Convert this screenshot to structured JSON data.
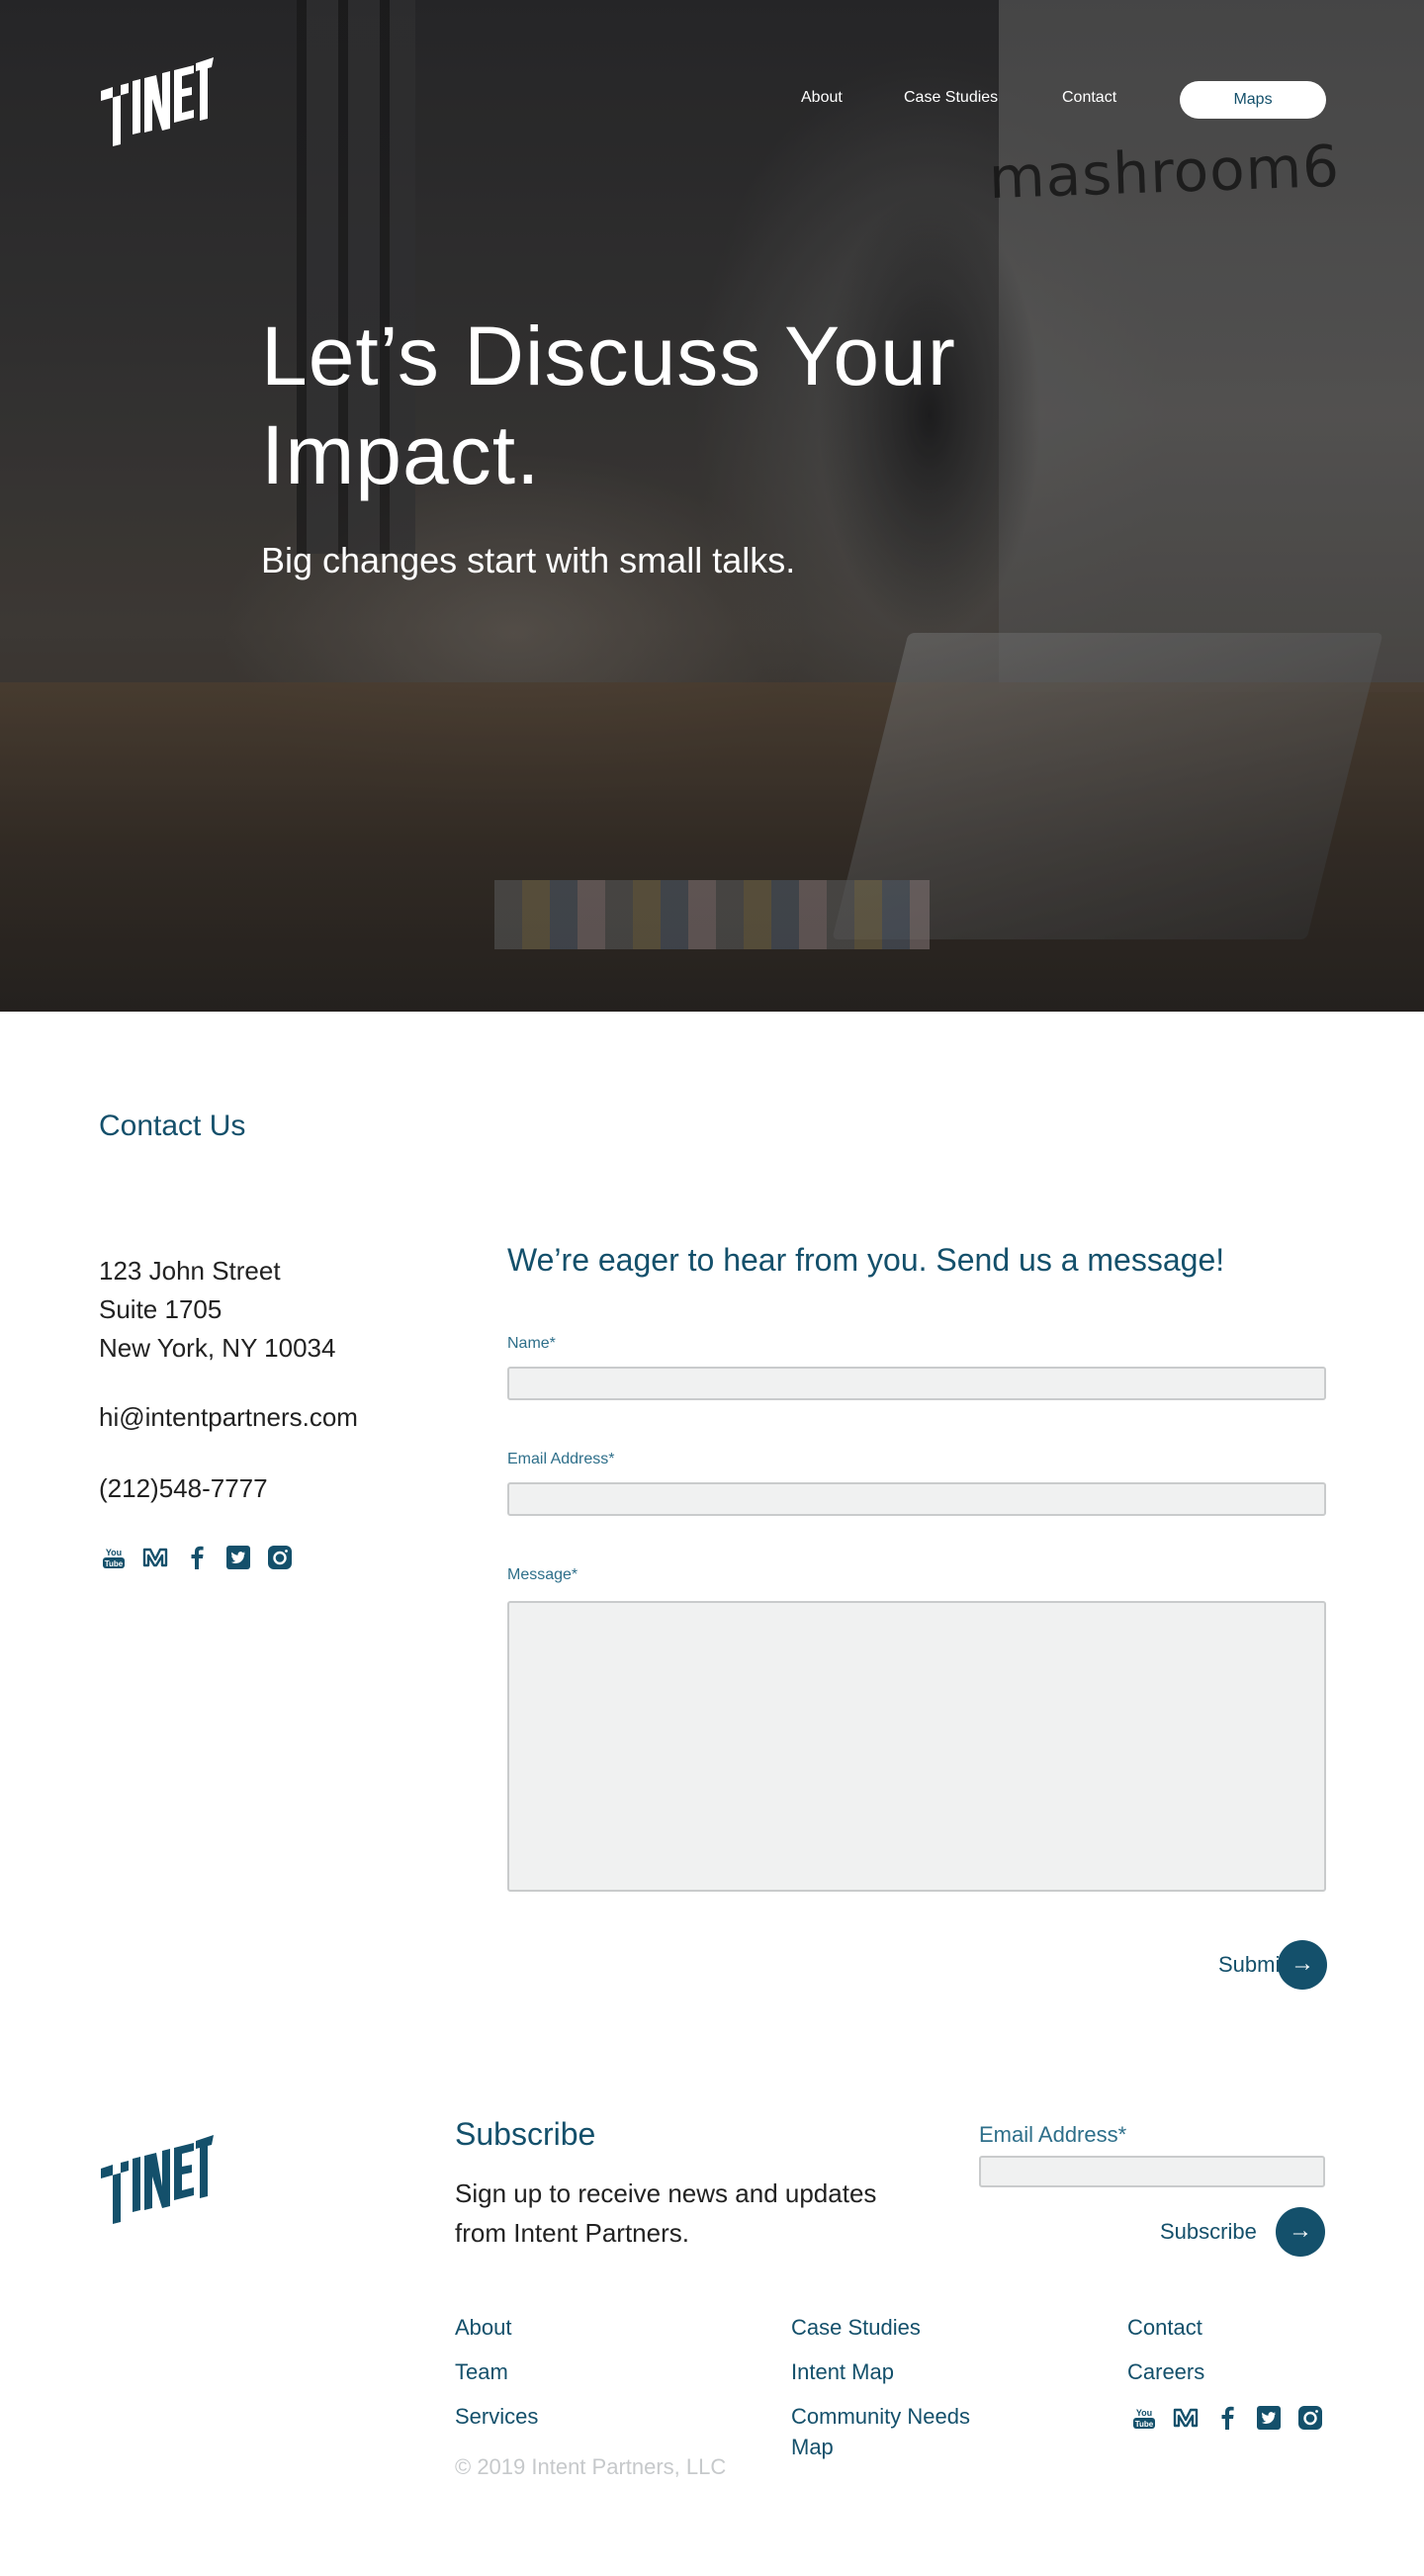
{
  "brand": {
    "logo_text": "Intent",
    "primary_color": "#14506b"
  },
  "nav": {
    "items": [
      {
        "label": "About"
      },
      {
        "label": "Case Studies"
      },
      {
        "label": "Contact"
      }
    ],
    "maps_button": "Maps"
  },
  "hero": {
    "title_line1": "Let’s Discuss Your",
    "title_line2": "Impact.",
    "subtitle": "Big changes start with small talks.",
    "background_sign": "mashroom6"
  },
  "contact": {
    "heading": "Contact Us",
    "address_lines": [
      "123 John Street",
      "Suite 1705",
      "New York, NY 10034"
    ],
    "email": "hi@intentpartners.com",
    "phone": "(212)548-7777",
    "social_icons": [
      "youtube-icon",
      "medium-icon",
      "facebook-icon",
      "twitter-icon",
      "instagram-icon"
    ]
  },
  "form": {
    "heading": "We’re eager to hear from you. Send us a message!",
    "name_label": "Name*",
    "name_value": "",
    "email_label": "Email Address*",
    "email_value": "",
    "message_label": "Message*",
    "message_value": "",
    "submit_label": "Submit",
    "submit_arrow": "→"
  },
  "footer": {
    "subscribe_heading": "Subscribe",
    "subscribe_text": "Sign up to receive news and updates from Intent Partners.",
    "email_label": "Email Address*",
    "email_value": "",
    "subscribe_button": "Subscribe",
    "subscribe_arrow": "→",
    "links": {
      "col1": [
        "About",
        "Team",
        "Services"
      ],
      "col2": [
        "Case Studies",
        "Intent Map",
        "Community Needs Map"
      ],
      "col3": [
        "Contact",
        "Careers"
      ]
    },
    "copyright": "© 2019 Intent Partners, LLC"
  }
}
